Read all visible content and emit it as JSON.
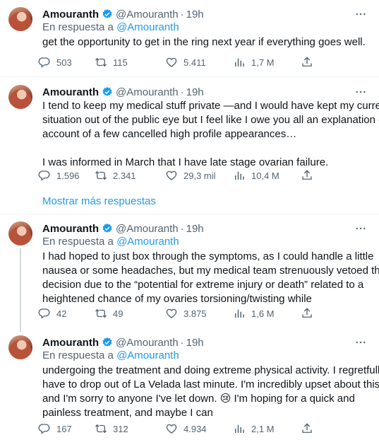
{
  "author": {
    "name": "Amouranth",
    "handle": "@Amouranth",
    "dot": "·"
  },
  "colors": {
    "accent": "#1d9bf0",
    "muted": "#536471",
    "text": "#0f1419"
  },
  "icons": {
    "reply": "reply-icon",
    "retweet": "retweet-icon",
    "like": "heart-icon",
    "views": "views-chart-icon",
    "share": "share-icon",
    "more": "more-dots-icon",
    "verified": "verified-badge-icon"
  },
  "show_more": "Mostrar más respuestas",
  "tweets": [
    {
      "time": "19h",
      "reply_prefix": "En respuesta a",
      "reply_handle": "@Amouranth",
      "lines": [
        "get the opportunity to get in the ring next year if everything goes well."
      ],
      "stats": {
        "replies": "503",
        "retweets": "115",
        "likes": "5.411",
        "views": "1,7 M"
      }
    },
    {
      "time": "19h",
      "lines": [
        "I tend to keep my medical stuff private —and I would have kept my current",
        "situation out of the public eye but I feel like I owe you all an explanation on",
        "account of a few cancelled high profile appearances…",
        "",
        "I was informed in March that I have late stage ovarian failure."
      ],
      "stats": {
        "replies": "1.596",
        "retweets": "2.341",
        "likes": "29,3 mil",
        "views": "10,4 M"
      }
    },
    {
      "time": "19h",
      "reply_prefix": "En respuesta a",
      "reply_handle": "@Amouranth",
      "lines": [
        "I had hoped to just box through the symptoms, as I could handle a little",
        "nausea or some headaches,  but my medical team strenuously vetoed that",
        "decision due to the “potential for extreme injury or death” related to a",
        "heightened chance of my ovaries torsioning/twisting while"
      ],
      "stats": {
        "replies": "42",
        "retweets": "49",
        "likes": "3.875",
        "views": "1,6 M"
      }
    },
    {
      "time": "19h",
      "reply_prefix": "En respuesta a",
      "reply_handle": "@Amouranth",
      "lines": [
        "undergoing the  treatment and doing extreme physical activity.  I regretfully",
        "have to drop out of La Velada last minute.  I'm incredibly upset about this,",
        "and I'm sorry to anyone I've let down. 😢 I'm hoping for a quick and",
        "painless treatment, and maybe I can"
      ],
      "stats": {
        "replies": "167",
        "retweets": "312",
        "likes": "4.934",
        "views": "2,1 M"
      }
    }
  ]
}
